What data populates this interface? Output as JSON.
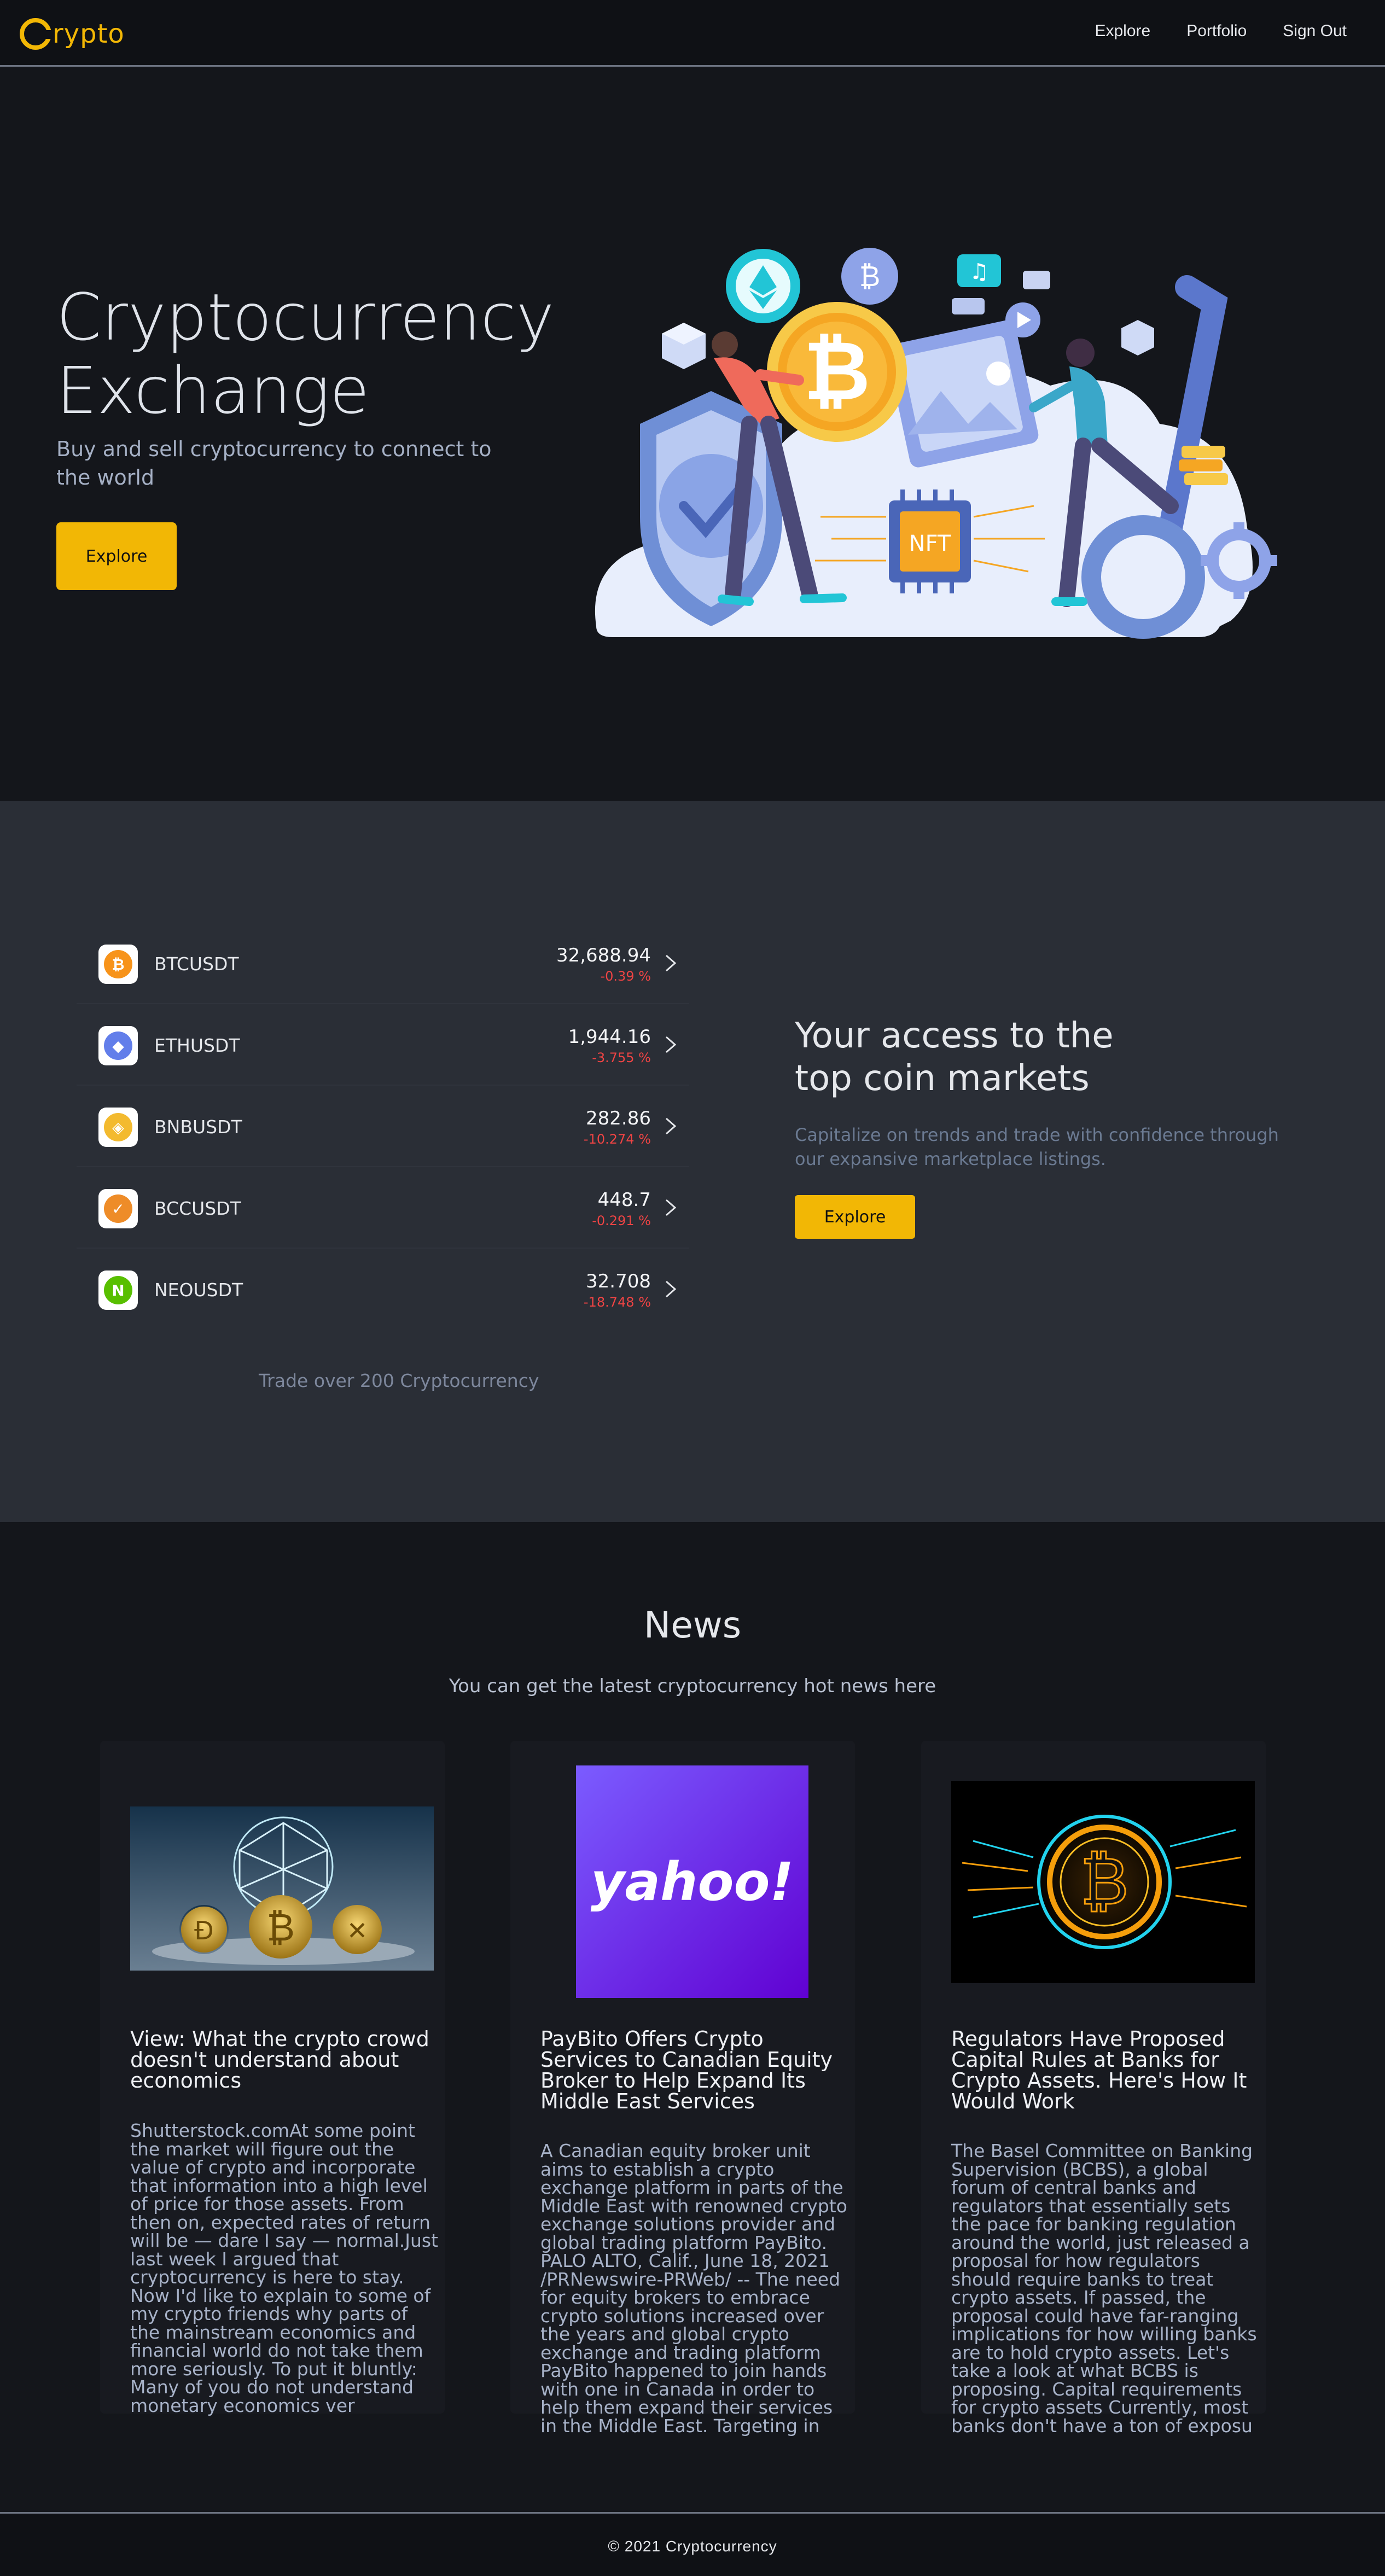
{
  "nav": {
    "logo_text": "rypto",
    "links": [
      "Explore",
      "Portfolio",
      "Sign Out"
    ]
  },
  "hero": {
    "title": "Cryptocurrency Exchange",
    "subtitle": "Buy and sell cryptocurrency to connect to the world",
    "button": "Explore",
    "illustration_label": "NFT"
  },
  "markets": {
    "coins": [
      {
        "pair": "BTCUSDT",
        "price": "32,688.94",
        "change": "-0.39 %",
        "icon": "bitcoin-icon",
        "color": "#f7931a",
        "glyph": "₿"
      },
      {
        "pair": "ETHUSDT",
        "price": "1,944.16",
        "change": "-3.755 %",
        "icon": "ethereum-icon",
        "color": "#627eea",
        "glyph": "◆"
      },
      {
        "pair": "BNBUSDT",
        "price": "282.86",
        "change": "-10.274 %",
        "icon": "binance-icon",
        "color": "#f3ba2f",
        "glyph": "◈"
      },
      {
        "pair": "BCCUSDT",
        "price": "448.7",
        "change": "-0.291 %",
        "icon": "bitcoin-cash-icon",
        "color": "#ee8c28",
        "glyph": "✓"
      },
      {
        "pair": "NEOUSDT",
        "price": "32.708",
        "change": "-18.748 %",
        "icon": "neo-icon",
        "color": "#58bf00",
        "glyph": "N"
      }
    ],
    "trade_note": "Trade over 200 Cryptocurrency",
    "access_title": "Your access to the top coin markets",
    "access_sub": "Capitalize on trends and trade with confidence through our expansive marketplace listings.",
    "access_button": "Explore"
  },
  "news": {
    "title": "News",
    "subtitle": "You can get the latest cryptocurrency hot news here",
    "articles": [
      {
        "title": "View: What the crypto crowd doesn't understand about economics",
        "body": "Shutterstock.comAt some point the market will figure out the value of crypto and incorporate that information into a high level of price for those assets. From then on, expected rates of return will be — dare I say — normal.Just last week I argued that cryptocurrency is here to stay. Now I'd like to explain to some of my crypto friends why parts of the mainstream economics and financial world do not take them more seriously. To put it bluntly: Many of you do not understand monetary economics ver"
      },
      {
        "title": "PayBito Offers Crypto Services to Canadian Equity Broker to Help Expand Its Middle East Services",
        "body": "A Canadian equity broker unit aims to establish a crypto exchange platform in parts of the Middle East with renowned crypto exchange solutions provider and global trading platform PayBito. PALO ALTO, Calif., June 18, 2021 /PRNewswire-PRWeb/ -- The need for equity brokers to embrace crypto solutions increased over the years and global crypto exchange and trading platform PayBito happened to join hands with one in Canada in order to help them expand their services in the Middle East. Targeting in",
        "logo_text": "yahoo!"
      },
      {
        "title": "Regulators Have Proposed Capital Rules at Banks for Crypto Assets. Here's How It Would Work",
        "body": "The Basel Committee on Banking Supervision (BCBS), a global forum of central banks and regulators that essentially sets the pace for banking regulation around the world, just released a proposal for how regulators should require banks to treat crypto assets. If passed, the proposal could have far-ranging implications for how willing banks are to hold crypto assets. Let's take a look at what BCBS is proposing. Capital requirements for crypto assets Currently, most banks don't have a ton of exposu"
      }
    ]
  },
  "footer": {
    "text": "© 2021 Cryptocurrency"
  },
  "colors": {
    "accent": "#f2b705",
    "negative": "#ef4444",
    "background": "#14161b",
    "panel": "#2a2e36"
  }
}
